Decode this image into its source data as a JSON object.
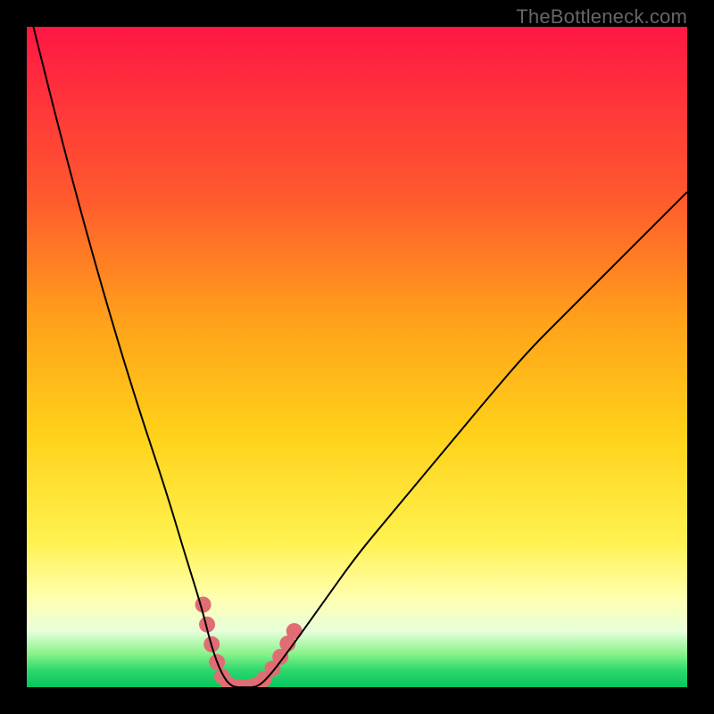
{
  "watermark": "TheBottleneck.com",
  "chart_data": {
    "type": "line",
    "title": "",
    "xlabel": "",
    "ylabel": "",
    "xlim": [
      0,
      100
    ],
    "ylim": [
      0,
      100
    ],
    "axes_visible": false,
    "gradient_stops": [
      {
        "offset": 0,
        "color": "#ff1744"
      },
      {
        "offset": 0.26,
        "color": "#ff5a2d"
      },
      {
        "offset": 0.45,
        "color": "#ffa31a"
      },
      {
        "offset": 0.62,
        "color": "#ffd21a"
      },
      {
        "offset": 0.78,
        "color": "#fff250"
      },
      {
        "offset": 0.865,
        "color": "#ffffb0"
      },
      {
        "offset": 0.915,
        "color": "#e8ffda"
      },
      {
        "offset": 0.95,
        "color": "#86f28a"
      },
      {
        "offset": 0.975,
        "color": "#2bd86d"
      },
      {
        "offset": 1.0,
        "color": "#08c45e"
      }
    ],
    "series": [
      {
        "name": "bottleneck-curve",
        "stroke": "#000000",
        "stroke_width": 2,
        "x": [
          1,
          5,
          9,
          13,
          17,
          21,
          24,
          26.5,
          28,
          29.5,
          31,
          33,
          35,
          37,
          40,
          45,
          50,
          55,
          60,
          65,
          70,
          76,
          82,
          88,
          94,
          100
        ],
        "y": [
          100,
          84,
          69,
          55,
          42,
          30,
          20,
          12,
          6,
          2,
          0,
          0,
          0,
          2,
          6,
          13,
          20,
          26,
          32,
          38,
          44,
          51,
          57,
          63,
          69,
          75
        ]
      }
    ],
    "markers": {
      "name": "highlighted-range",
      "color": "#e16d74",
      "radius": 9,
      "points": [
        {
          "x": 26.7,
          "y": 12.5
        },
        {
          "x": 27.3,
          "y": 9.5
        },
        {
          "x": 28.0,
          "y": 6.5
        },
        {
          "x": 28.8,
          "y": 3.8
        },
        {
          "x": 29.6,
          "y": 1.6
        },
        {
          "x": 30.6,
          "y": 0.4
        },
        {
          "x": 31.8,
          "y": 0.0
        },
        {
          "x": 33.1,
          "y": 0.0
        },
        {
          "x": 34.5,
          "y": 0.2
        },
        {
          "x": 35.9,
          "y": 1.2
        },
        {
          "x": 37.2,
          "y": 2.8
        },
        {
          "x": 38.4,
          "y": 4.6
        },
        {
          "x": 39.5,
          "y": 6.6
        },
        {
          "x": 40.5,
          "y": 8.5
        }
      ]
    }
  }
}
